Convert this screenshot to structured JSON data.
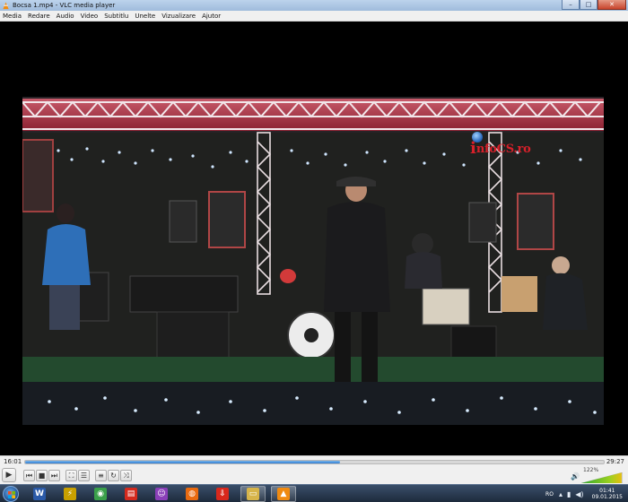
{
  "window": {
    "title": "Bocsa 1.mp4 - VLC media player",
    "buttons": {
      "minimize": "–",
      "maximize": "□",
      "close": "✕"
    }
  },
  "menu": [
    "Media",
    "Redare",
    "Audio",
    "Video",
    "Subtitlu",
    "Unelte",
    "Vizualizare",
    "Ajutor"
  ],
  "video": {
    "watermark": {
      "prefix": "i",
      "text": "nfoCS.ro",
      "color": "#d6202a"
    }
  },
  "playback": {
    "elapsed": "16:01",
    "total": "29:27",
    "progress": 0.544
  },
  "controls": {
    "play": "▶",
    "prev": "⏮",
    "stop": "■",
    "next": "⏭",
    "fullscreen": "⛶",
    "extended": "☰",
    "playlist": "≡",
    "loop": "↻",
    "shuffle": "⤨"
  },
  "volume": {
    "percent": "122%",
    "level": 1.22,
    "icon": "speaker-icon"
  },
  "taskbar": {
    "apps": [
      {
        "name": "word-icon",
        "glyph": "W",
        "color": "#2b5aa8"
      },
      {
        "name": "winamp-icon",
        "glyph": "⚡",
        "color": "#c8a000"
      },
      {
        "name": "chrome-icon",
        "glyph": "◉",
        "color": "#3aa04a"
      },
      {
        "name": "pdf-reader-icon",
        "glyph": "▤",
        "color": "#d42a1e"
      },
      {
        "name": "messenger-icon",
        "glyph": "☺",
        "color": "#8a3fb8"
      },
      {
        "name": "firefox-icon",
        "glyph": "◍",
        "color": "#e86a10"
      },
      {
        "name": "download-manager-icon",
        "glyph": "⇩",
        "color": "#d8281c"
      },
      {
        "name": "explorer-icon",
        "glyph": "▭",
        "color": "#d6b44a"
      },
      {
        "name": "vlc-icon",
        "glyph": "▲",
        "color": "#f08a10"
      }
    ],
    "tray": {
      "language": "RO",
      "time": "01:41",
      "date": "09.01.2015"
    }
  }
}
